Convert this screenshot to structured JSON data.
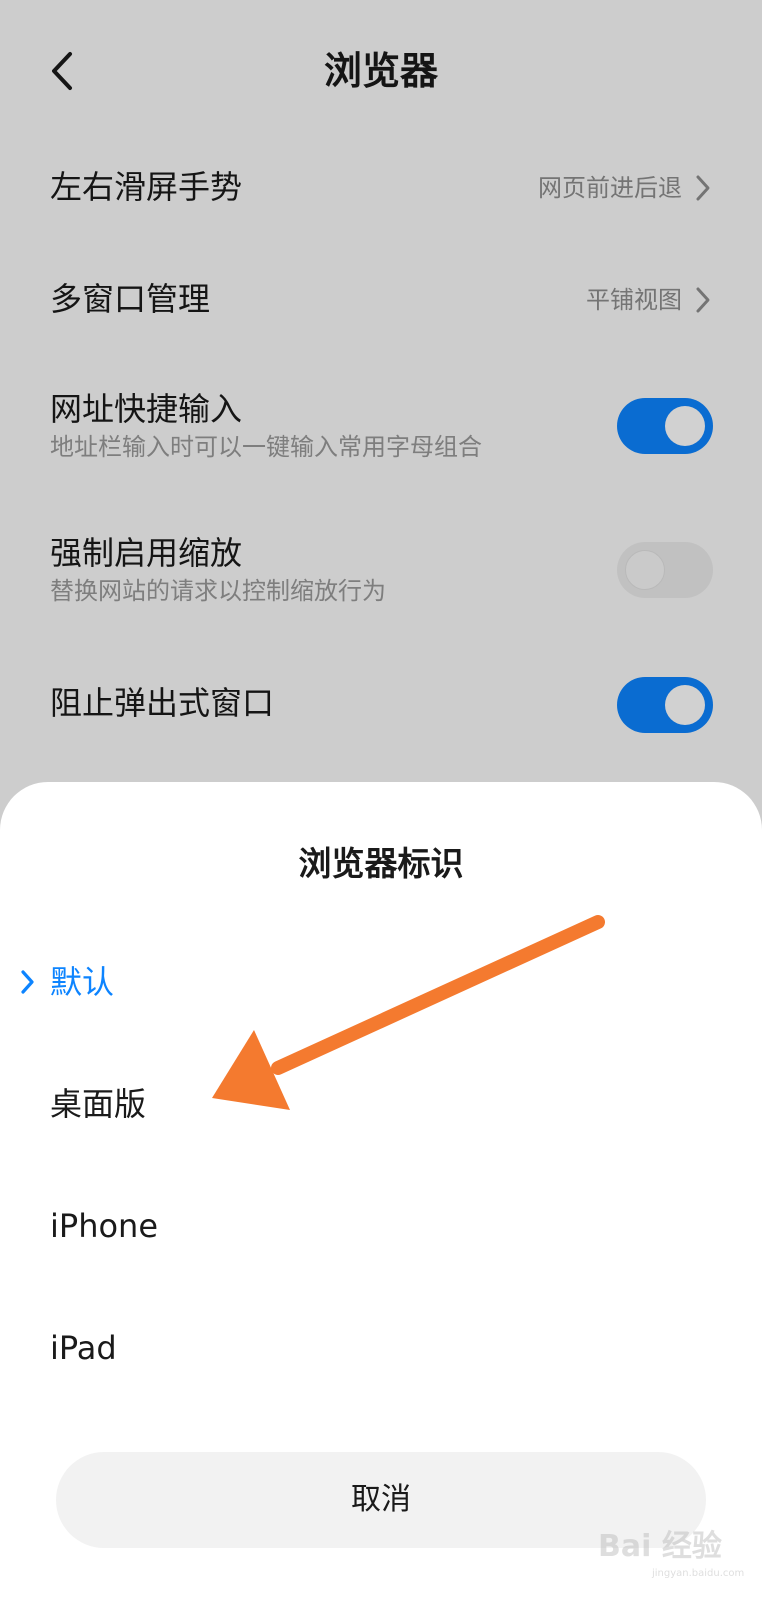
{
  "header": {
    "title": "浏览器"
  },
  "settings": [
    {
      "title": "左右滑屏手势",
      "value": "网页前进后退"
    },
    {
      "title": "多窗口管理",
      "value": "平铺视图"
    },
    {
      "title": "网址快捷输入",
      "subtitle": "地址栏输入时可以一键输入常用字母组合",
      "toggle": "on"
    },
    {
      "title": "强制启用缩放",
      "subtitle": "替换网站的请求以控制缩放行为",
      "toggle": "off"
    },
    {
      "title": "阻止弹出式窗口",
      "toggle": "on"
    }
  ],
  "sheet": {
    "title": "浏览器标识",
    "options": [
      {
        "label": "默认",
        "selected": true
      },
      {
        "label": "桌面版",
        "selected": false
      },
      {
        "label": "iPhone",
        "selected": false
      },
      {
        "label": "iPad",
        "selected": false
      }
    ],
    "cancel_label": "取消"
  },
  "colors": {
    "accent": "#0d84ff",
    "annotation_arrow": "#f47a2f"
  },
  "icons": [
    "back-arrow-icon",
    "chevron-right-icon",
    "checkmark-icon"
  ],
  "watermark": {
    "text": "Bai 经验",
    "url": "jingyan.baidu.com"
  }
}
